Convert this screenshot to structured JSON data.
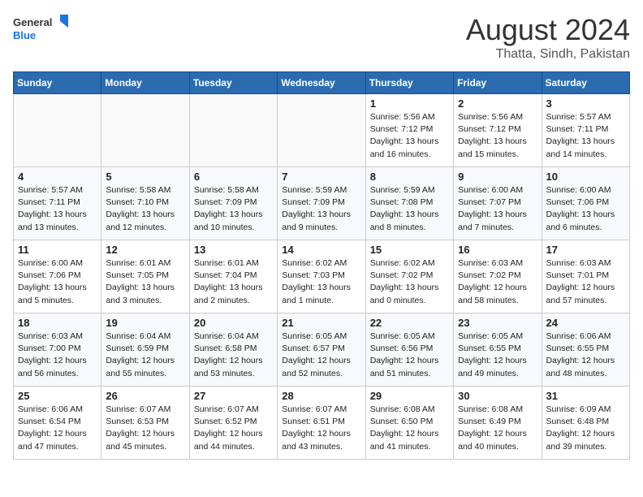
{
  "header": {
    "logo_line1": "General",
    "logo_line2": "Blue",
    "month_year": "August 2024",
    "location": "Thatta, Sindh, Pakistan"
  },
  "weekdays": [
    "Sunday",
    "Monday",
    "Tuesday",
    "Wednesday",
    "Thursday",
    "Friday",
    "Saturday"
  ],
  "weeks": [
    [
      {
        "day": "",
        "info": ""
      },
      {
        "day": "",
        "info": ""
      },
      {
        "day": "",
        "info": ""
      },
      {
        "day": "",
        "info": ""
      },
      {
        "day": "1",
        "info": "Sunrise: 5:56 AM\nSunset: 7:12 PM\nDaylight: 13 hours\nand 16 minutes."
      },
      {
        "day": "2",
        "info": "Sunrise: 5:56 AM\nSunset: 7:12 PM\nDaylight: 13 hours\nand 15 minutes."
      },
      {
        "day": "3",
        "info": "Sunrise: 5:57 AM\nSunset: 7:11 PM\nDaylight: 13 hours\nand 14 minutes."
      }
    ],
    [
      {
        "day": "4",
        "info": "Sunrise: 5:57 AM\nSunset: 7:11 PM\nDaylight: 13 hours\nand 13 minutes."
      },
      {
        "day": "5",
        "info": "Sunrise: 5:58 AM\nSunset: 7:10 PM\nDaylight: 13 hours\nand 12 minutes."
      },
      {
        "day": "6",
        "info": "Sunrise: 5:58 AM\nSunset: 7:09 PM\nDaylight: 13 hours\nand 10 minutes."
      },
      {
        "day": "7",
        "info": "Sunrise: 5:59 AM\nSunset: 7:09 PM\nDaylight: 13 hours\nand 9 minutes."
      },
      {
        "day": "8",
        "info": "Sunrise: 5:59 AM\nSunset: 7:08 PM\nDaylight: 13 hours\nand 8 minutes."
      },
      {
        "day": "9",
        "info": "Sunrise: 6:00 AM\nSunset: 7:07 PM\nDaylight: 13 hours\nand 7 minutes."
      },
      {
        "day": "10",
        "info": "Sunrise: 6:00 AM\nSunset: 7:06 PM\nDaylight: 13 hours\nand 6 minutes."
      }
    ],
    [
      {
        "day": "11",
        "info": "Sunrise: 6:00 AM\nSunset: 7:06 PM\nDaylight: 13 hours\nand 5 minutes."
      },
      {
        "day": "12",
        "info": "Sunrise: 6:01 AM\nSunset: 7:05 PM\nDaylight: 13 hours\nand 3 minutes."
      },
      {
        "day": "13",
        "info": "Sunrise: 6:01 AM\nSunset: 7:04 PM\nDaylight: 13 hours\nand 2 minutes."
      },
      {
        "day": "14",
        "info": "Sunrise: 6:02 AM\nSunset: 7:03 PM\nDaylight: 13 hours\nand 1 minute."
      },
      {
        "day": "15",
        "info": "Sunrise: 6:02 AM\nSunset: 7:02 PM\nDaylight: 13 hours\nand 0 minutes."
      },
      {
        "day": "16",
        "info": "Sunrise: 6:03 AM\nSunset: 7:02 PM\nDaylight: 12 hours\nand 58 minutes."
      },
      {
        "day": "17",
        "info": "Sunrise: 6:03 AM\nSunset: 7:01 PM\nDaylight: 12 hours\nand 57 minutes."
      }
    ],
    [
      {
        "day": "18",
        "info": "Sunrise: 6:03 AM\nSunset: 7:00 PM\nDaylight: 12 hours\nand 56 minutes."
      },
      {
        "day": "19",
        "info": "Sunrise: 6:04 AM\nSunset: 6:59 PM\nDaylight: 12 hours\nand 55 minutes."
      },
      {
        "day": "20",
        "info": "Sunrise: 6:04 AM\nSunset: 6:58 PM\nDaylight: 12 hours\nand 53 minutes."
      },
      {
        "day": "21",
        "info": "Sunrise: 6:05 AM\nSunset: 6:57 PM\nDaylight: 12 hours\nand 52 minutes."
      },
      {
        "day": "22",
        "info": "Sunrise: 6:05 AM\nSunset: 6:56 PM\nDaylight: 12 hours\nand 51 minutes."
      },
      {
        "day": "23",
        "info": "Sunrise: 6:05 AM\nSunset: 6:55 PM\nDaylight: 12 hours\nand 49 minutes."
      },
      {
        "day": "24",
        "info": "Sunrise: 6:06 AM\nSunset: 6:55 PM\nDaylight: 12 hours\nand 48 minutes."
      }
    ],
    [
      {
        "day": "25",
        "info": "Sunrise: 6:06 AM\nSunset: 6:54 PM\nDaylight: 12 hours\nand 47 minutes."
      },
      {
        "day": "26",
        "info": "Sunrise: 6:07 AM\nSunset: 6:53 PM\nDaylight: 12 hours\nand 45 minutes."
      },
      {
        "day": "27",
        "info": "Sunrise: 6:07 AM\nSunset: 6:52 PM\nDaylight: 12 hours\nand 44 minutes."
      },
      {
        "day": "28",
        "info": "Sunrise: 6:07 AM\nSunset: 6:51 PM\nDaylight: 12 hours\nand 43 minutes."
      },
      {
        "day": "29",
        "info": "Sunrise: 6:08 AM\nSunset: 6:50 PM\nDaylight: 12 hours\nand 41 minutes."
      },
      {
        "day": "30",
        "info": "Sunrise: 6:08 AM\nSunset: 6:49 PM\nDaylight: 12 hours\nand 40 minutes."
      },
      {
        "day": "31",
        "info": "Sunrise: 6:09 AM\nSunset: 6:48 PM\nDaylight: 12 hours\nand 39 minutes."
      }
    ]
  ]
}
